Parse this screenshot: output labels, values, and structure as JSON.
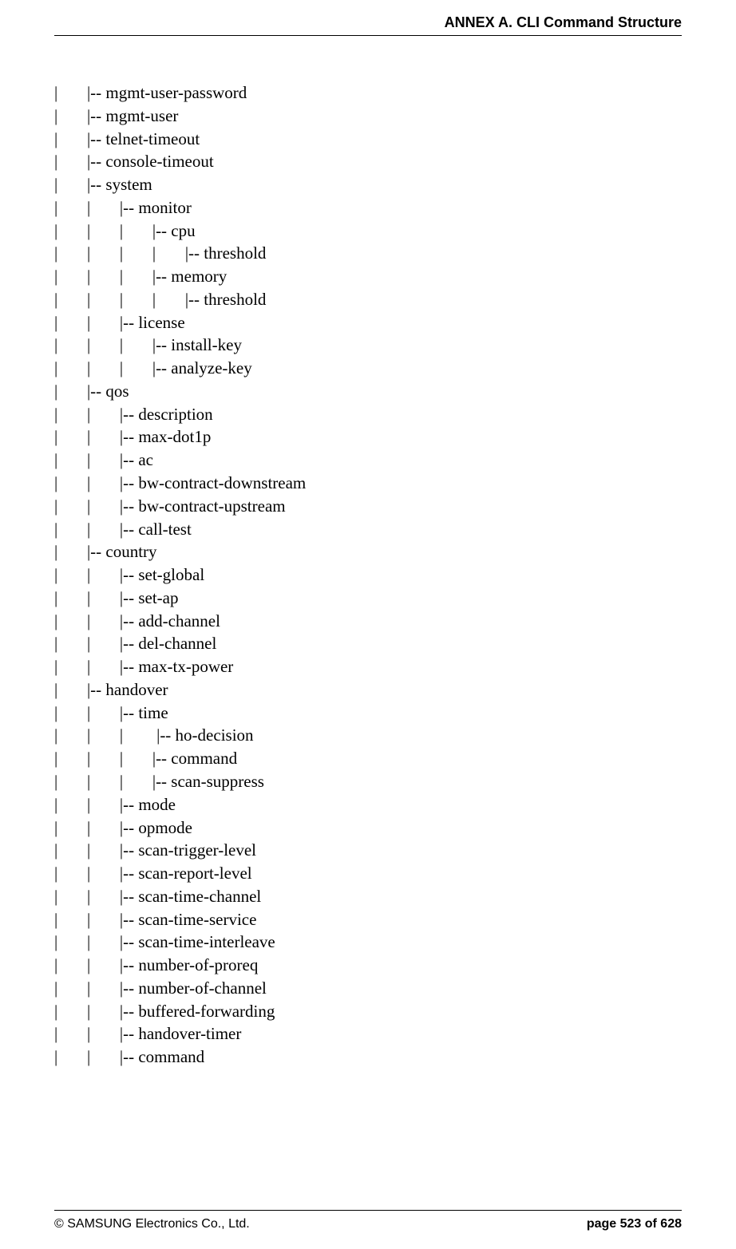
{
  "header": {
    "title": "ANNEX A. CLI Command Structure"
  },
  "footer": {
    "left": "© SAMSUNG Electronics Co., Ltd.",
    "right": "page 523 of 628"
  },
  "lines": [
    "|       |-- mgmt-user-password",
    "|       |-- mgmt-user",
    "|       |-- telnet-timeout",
    "|       |-- console-timeout",
    "|       |-- system",
    "|       |       |-- monitor",
    "|       |       |       |-- cpu",
    "|       |       |       |       |-- threshold",
    "|       |       |       |-- memory",
    "|       |       |       |       |-- threshold",
    "|       |       |-- license",
    "|       |       |       |-- install-key",
    "|       |       |       |-- analyze-key",
    "|       |-- qos",
    "|       |       |-- description",
    "|       |       |-- max-dot1p",
    "|       |       |-- ac",
    "|       |       |-- bw-contract-downstream",
    "|       |       |-- bw-contract-upstream",
    "|       |       |-- call-test",
    "|       |-- country",
    "|       |       |-- set-global",
    "|       |       |-- set-ap",
    "|       |       |-- add-channel",
    "|       |       |-- del-channel",
    "|       |       |-- max-tx-power",
    "|       |-- handover",
    "|       |       |-- time",
    "|       |       |        |-- ho-decision",
    "|       |       |       |-- command",
    "|       |       |       |-- scan-suppress",
    "|       |       |-- mode",
    "|       |       |-- opmode",
    "|       |       |-- scan-trigger-level",
    "|       |       |-- scan-report-level",
    "|       |       |-- scan-time-channel",
    "|       |       |-- scan-time-service",
    "|       |       |-- scan-time-interleave",
    "|       |       |-- number-of-proreq",
    "|       |       |-- number-of-channel",
    "|       |       |-- buffered-forwarding",
    "|       |       |-- handover-timer",
    "|       |       |-- command"
  ]
}
